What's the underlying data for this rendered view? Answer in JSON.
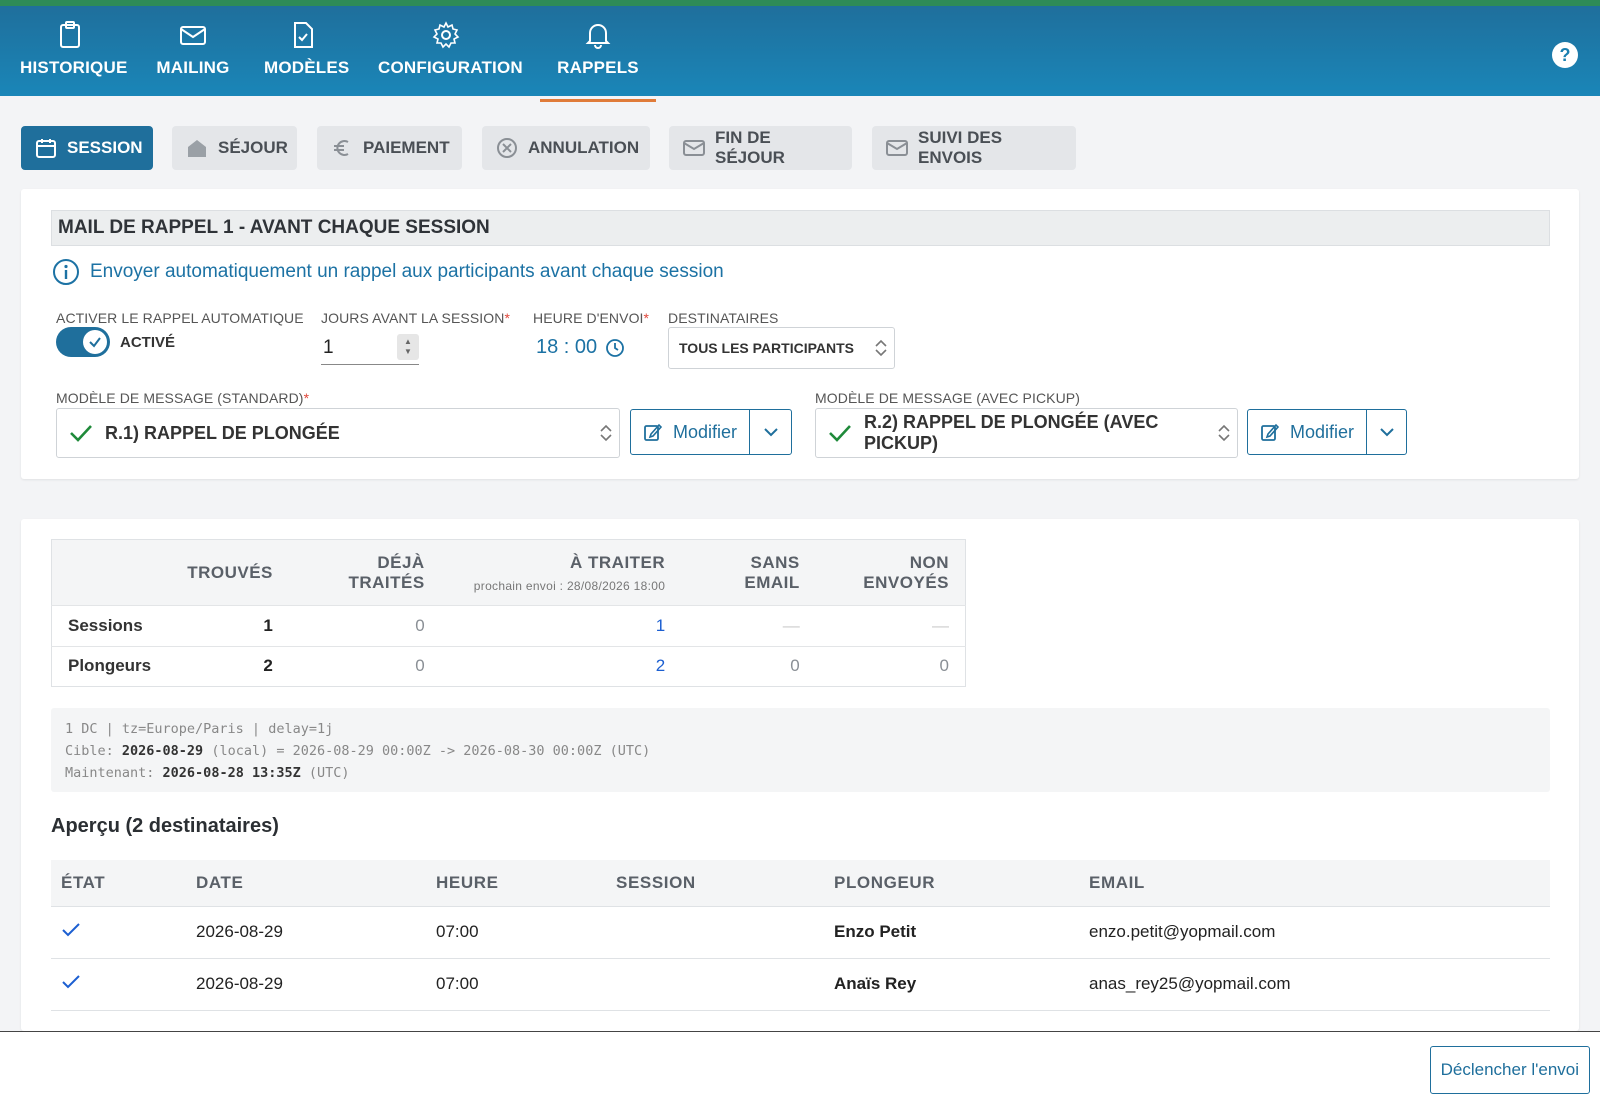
{
  "nav": {
    "items": [
      {
        "label": "HISTORIQUE",
        "icon": "clipboard-icon"
      },
      {
        "label": "MAILING",
        "icon": "envelope-icon"
      },
      {
        "label": "MODÈLES",
        "icon": "document-check-icon"
      },
      {
        "label": "CONFIGURATION",
        "icon": "gear-icon"
      },
      {
        "label": "RAPPELS",
        "icon": "bell-icon"
      }
    ],
    "active": "RAPPELS",
    "help": "?"
  },
  "tabs": [
    {
      "label": "SESSION",
      "icon": "calendar-icon"
    },
    {
      "label": "SÉJOUR",
      "icon": "home-icon"
    },
    {
      "label": "PAIEMENT",
      "icon": "euro-icon"
    },
    {
      "label": "ANNULATION",
      "icon": "cancel-circle-icon"
    },
    {
      "label": "FIN DE SÉJOUR",
      "icon": "envelope-icon"
    },
    {
      "label": "SUIVI DES ENVOIS",
      "icon": "envelope-icon"
    }
  ],
  "reminder": {
    "title": "MAIL DE RAPPEL 1 - AVANT CHAQUE SESSION",
    "info": "Envoyer automatiquement un rappel aux participants avant chaque session",
    "toggle_label": "ACTIVER LE RAPPEL AUTOMATIQUE",
    "toggle_state": "ACTIVÉ",
    "days_label": "JOURS AVANT LA SESSION",
    "days_value": "1",
    "time_label": "HEURE D'ENVOI",
    "time_value": "18 : 00",
    "recipients_label": "DESTINATAIRES",
    "recipients_value": "TOUS LES PARTICIPANTS",
    "required_mark": "*",
    "template_std_label": "MODÈLE DE MESSAGE (STANDARD)",
    "template_std_value": "R.1) RAPPEL DE PLONGÉE",
    "template_pickup_label": "MODÈLE DE MESSAGE (AVEC PICKUP)",
    "template_pickup_value": "R.2) RAPPEL DE PLONGÉE (AVEC PICKUP)",
    "modify_label": "Modifier"
  },
  "stats": {
    "headers": [
      "",
      "TROUVÉS",
      "DÉJÀ TRAITÉS",
      "À TRAITER",
      "SANS EMAIL",
      "NON ENVOYÉS"
    ],
    "next_send": "prochain envoi : 28/08/2026 18:00",
    "rows": [
      {
        "label": "Sessions",
        "found": "1",
        "done": "0",
        "todo": "1",
        "no_email": "—",
        "not_sent": "—"
      },
      {
        "label": "Plongeurs",
        "found": "2",
        "done": "0",
        "todo": "2",
        "no_email": "0",
        "not_sent": "0"
      }
    ]
  },
  "debug": {
    "line1": "1 DC | tz=Europe/Paris | delay=1j",
    "line2_prefix": "Cible: ",
    "line2_bold": "2026-08-29",
    "line2_rest": " (local) = 2026-08-29 00:00Z -> 2026-08-30 00:00Z (UTC)",
    "line3_prefix": "Maintenant: ",
    "line3_bold": "2026-08-28 13:35Z",
    "line3_rest": " (UTC)"
  },
  "preview": {
    "title": "Aperçu (2 destinataires)",
    "headers": [
      "ÉTAT",
      "DATE",
      "HEURE",
      "SESSION",
      "PLONGEUR",
      "EMAIL"
    ],
    "rows": [
      {
        "date": "2026-08-29",
        "time": "07:00",
        "session": "",
        "diver": "Enzo Petit",
        "email": "enzo.petit@yopmail.com"
      },
      {
        "date": "2026-08-29",
        "time": "07:00",
        "session": "",
        "diver": "Anaïs Rey",
        "email": "anas_rey25@yopmail.com"
      }
    ]
  },
  "footer": {
    "trigger_label": "Déclencher l'envoi"
  },
  "colors": {
    "primary": "#1f6f9c",
    "accent": "#e07b39",
    "link": "#1c5fd1",
    "required": "#e0473a",
    "check": "#1f8a3a"
  }
}
